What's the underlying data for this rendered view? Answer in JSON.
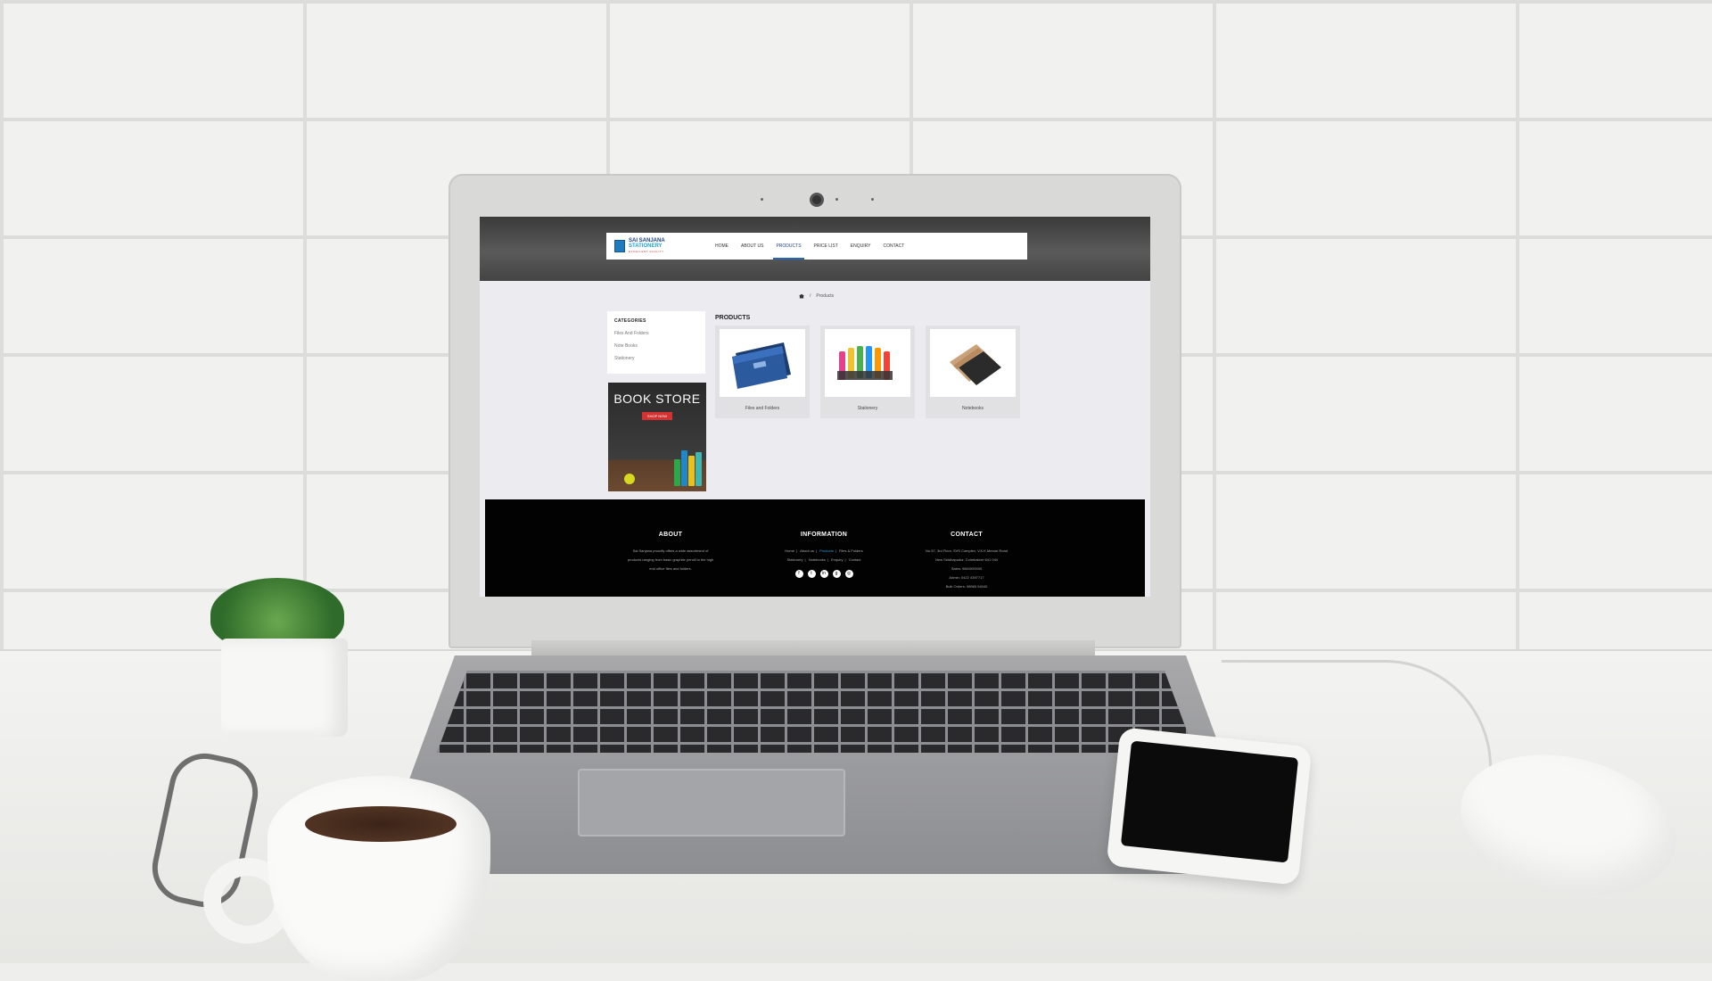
{
  "site": {
    "logo": {
      "line1": "SAI SANJANA",
      "line2": "STATIONERY",
      "line3": "EXCELLENT QUALITY"
    },
    "nav": [
      "HOME",
      "ABOUT US",
      "PRODUCTS",
      "PRICE LIST",
      "ENQUIRY",
      "CONTACT"
    ],
    "active_nav": "PRODUCTS",
    "breadcrumb": {
      "current": "Products"
    },
    "sidebar": {
      "title": "CATEGORIES",
      "items": [
        "Files And Folders",
        "Note Books",
        "Stationery"
      ]
    },
    "banner": {
      "title": "BOOK STORE",
      "button": "SHOP NOW"
    },
    "products": {
      "title": "PRODUCTS",
      "items": [
        {
          "label": "Files and Folders",
          "icon": "folder-icon"
        },
        {
          "label": "Stationery",
          "icon": "markers-icon"
        },
        {
          "label": "Notebooks",
          "icon": "notebook-icon"
        }
      ]
    },
    "footer": {
      "about": {
        "title": "ABOUT",
        "text": "Sai Sanjana proudly offers a wide assortment of products ranging from basic graphite pencil to the high end office files and folders."
      },
      "information": {
        "title": "INFORMATION",
        "links_row1": [
          "Home",
          "About us",
          "Products",
          "Files & Folders"
        ],
        "links_row2": [
          "Stationery",
          "Notebooks",
          "Enquiry",
          "Contact"
        ],
        "highlight": "Products",
        "social": [
          "facebook-icon",
          "twitter-icon",
          "linkedin-icon",
          "google-plus-icon",
          "instagram-icon"
        ]
      },
      "contact": {
        "title": "CONTACT",
        "address1": "No.57, 3rd Floor, SVS Complex, V.K.K.Menon Road",
        "address2": "New Siddhapudur, Coimbatore 641 044",
        "sales": "Sales: 9840000000",
        "admin": "Admin: 0422 4397717",
        "bulk": "Bulk Orders: 98965 54040"
      }
    }
  },
  "colors": {
    "accent": "#2a66b8",
    "banner_button": "#d23232",
    "footer_bg": "#020202"
  }
}
